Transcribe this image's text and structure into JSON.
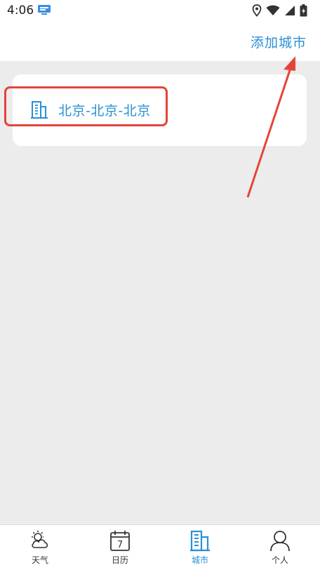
{
  "status_bar": {
    "time": "4:06",
    "app_icon": "notification-app-icon",
    "icons": [
      "location-icon",
      "wifi-icon",
      "signal-icon",
      "battery-icon"
    ]
  },
  "header": {
    "add_city_label": "添加城市"
  },
  "city_list": [
    {
      "name": "北京-北京-北京",
      "icon": "building-icon"
    }
  ],
  "bottom_nav": {
    "items": [
      {
        "label": "天气",
        "icon": "weather-icon",
        "active": false
      },
      {
        "label": "日历",
        "icon": "calendar-icon",
        "active": false
      },
      {
        "label": "城市",
        "icon": "city-icon",
        "active": true
      },
      {
        "label": "个人",
        "icon": "person-icon",
        "active": false
      }
    ]
  },
  "calendar_icon_day": "7",
  "colors": {
    "accent": "#2a8fd6",
    "background": "#ececec",
    "annotation": "#e4453a"
  }
}
